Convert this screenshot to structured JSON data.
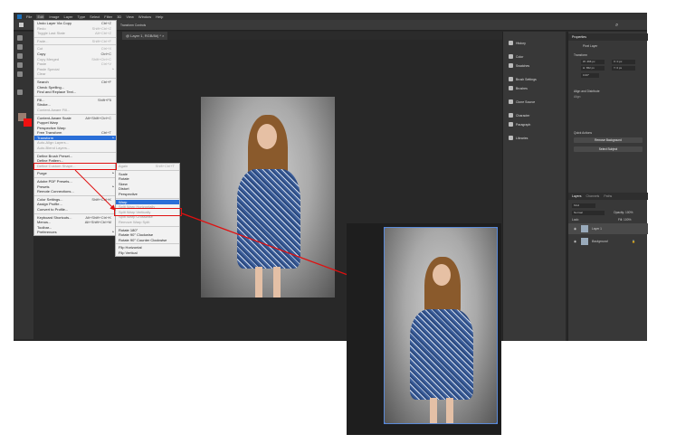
{
  "menubar": [
    "File",
    "Edit",
    "Image",
    "Layer",
    "Type",
    "Select",
    "Filter",
    "3D",
    "View",
    "Window",
    "Help"
  ],
  "doc_tab": "@ Layer 1, RGB/8#) *",
  "options": {
    "transform_controls": "Transform Controls"
  },
  "edit_menu": [
    {
      "label": "Undo Layer Via Copy",
      "sc": "Ctrl+Z"
    },
    {
      "label": "Redo",
      "sc": "Shift+Ctrl+Z",
      "dis": true
    },
    {
      "label": "Toggle Last State",
      "sc": "Alt+Ctrl+Z",
      "dis": true
    },
    {
      "sep": true
    },
    {
      "label": "Fade...",
      "sc": "Shift+Ctrl+F",
      "dis": true
    },
    {
      "sep": true
    },
    {
      "label": "Cut",
      "sc": "Ctrl+X",
      "dis": true
    },
    {
      "label": "Copy",
      "sc": "Ctrl+C"
    },
    {
      "label": "Copy Merged",
      "sc": "Shift+Ctrl+C",
      "dis": true
    },
    {
      "label": "Paste",
      "sc": "Ctrl+V",
      "dis": true
    },
    {
      "label": "Paste Special",
      "sc": "",
      "dis": true,
      "sub": true
    },
    {
      "label": "Clear",
      "sc": "",
      "dis": true
    },
    {
      "sep": true
    },
    {
      "label": "Search",
      "sc": "Ctrl+F"
    },
    {
      "label": "Check Spelling...",
      "sc": ""
    },
    {
      "label": "Find and Replace Text...",
      "sc": ""
    },
    {
      "sep": true
    },
    {
      "label": "Fill...",
      "sc": "Shift+F5"
    },
    {
      "label": "Stroke...",
      "sc": ""
    },
    {
      "label": "Content-Aware Fill...",
      "sc": "",
      "dis": true
    },
    {
      "sep": true
    },
    {
      "label": "Content-Aware Scale",
      "sc": "Alt+Shift+Ctrl+C"
    },
    {
      "label": "Puppet Warp",
      "sc": ""
    },
    {
      "label": "Perspective Warp",
      "sc": ""
    },
    {
      "label": "Free Transform",
      "sc": "Ctrl+T"
    },
    {
      "label": "Transform",
      "sc": "",
      "hl": true,
      "sub": true
    },
    {
      "label": "Auto-Align Layers...",
      "sc": "",
      "dis": true
    },
    {
      "label": "Auto-Blend Layers...",
      "sc": "",
      "dis": true
    },
    {
      "sep": true
    },
    {
      "label": "Define Brush Preset...",
      "sc": ""
    },
    {
      "label": "Define Pattern...",
      "sc": ""
    },
    {
      "label": "Define Custom Shape...",
      "sc": "",
      "dis": true
    },
    {
      "sep": true
    },
    {
      "label": "Purge",
      "sc": "",
      "sub": true
    },
    {
      "sep": true
    },
    {
      "label": "Adobe PDF Presets...",
      "sc": ""
    },
    {
      "label": "Presets",
      "sc": "",
      "sub": true
    },
    {
      "label": "Remote Connections...",
      "sc": ""
    },
    {
      "sep": true
    },
    {
      "label": "Color Settings...",
      "sc": "Shift+Ctrl+K"
    },
    {
      "label": "Assign Profile...",
      "sc": ""
    },
    {
      "label": "Convert to Profile...",
      "sc": ""
    },
    {
      "sep": true
    },
    {
      "label": "Keyboard Shortcuts...",
      "sc": "Alt+Shift+Ctrl+K"
    },
    {
      "label": "Menus...",
      "sc": "Alt+Shift+Ctrl+M"
    },
    {
      "label": "Toolbar...",
      "sc": ""
    },
    {
      "label": "Preferences",
      "sc": "",
      "sub": true
    }
  ],
  "transform_menu": [
    {
      "label": "Again",
      "sc": "Shift+Ctrl+T",
      "dis": true
    },
    {
      "sep": true
    },
    {
      "label": "Scale"
    },
    {
      "label": "Rotate"
    },
    {
      "label": "Skew"
    },
    {
      "label": "Distort"
    },
    {
      "label": "Perspective"
    },
    {
      "sep": true
    },
    {
      "label": "Warp",
      "hl": true
    },
    {
      "label": "Split Warp Horizontally",
      "dis": true
    },
    {
      "label": "Split Warp Vertically",
      "dis": true
    },
    {
      "label": "Split Warp Crosswise",
      "dis": true
    },
    {
      "label": "Remove Warp Split",
      "dis": true
    },
    {
      "sep": true
    },
    {
      "label": "Rotate 180°"
    },
    {
      "label": "Rotate 90° Clockwise"
    },
    {
      "label": "Rotate 90° Counter Clockwise"
    },
    {
      "sep": true
    },
    {
      "label": "Flip Horizontal"
    },
    {
      "label": "Flip Vertical"
    }
  ],
  "panels_col": [
    "History",
    "Color",
    "Swatches",
    "Brush Settings",
    "Brushes",
    "Clone Source",
    "Character",
    "Paragraph",
    "Libraries"
  ],
  "properties": {
    "title": "Properties",
    "layer_type": "Pixel Layer",
    "transform": "Transform",
    "w": "W: 466 px",
    "h": "H: 652 px",
    "x": "X: 0 px",
    "y": "Y: 0 px",
    "angle": "0.00°",
    "align": "Align and Distribute",
    "align_sub": "Align:",
    "quick": "Quick Actions",
    "remove_bg": "Remove Background",
    "select_subject": "Select Subject"
  },
  "layers": {
    "tabs": [
      "Layers",
      "Channels",
      "Paths"
    ],
    "kind": "Kind",
    "blend": "Normal",
    "opacity": "Opacity: 100%",
    "lock": "Lock:",
    "fill": "Fill: 100%",
    "items": [
      "Layer 1",
      "Background"
    ]
  },
  "colors": {
    "accent": "#2a6fd8",
    "highlight_box": "#e01010"
  }
}
